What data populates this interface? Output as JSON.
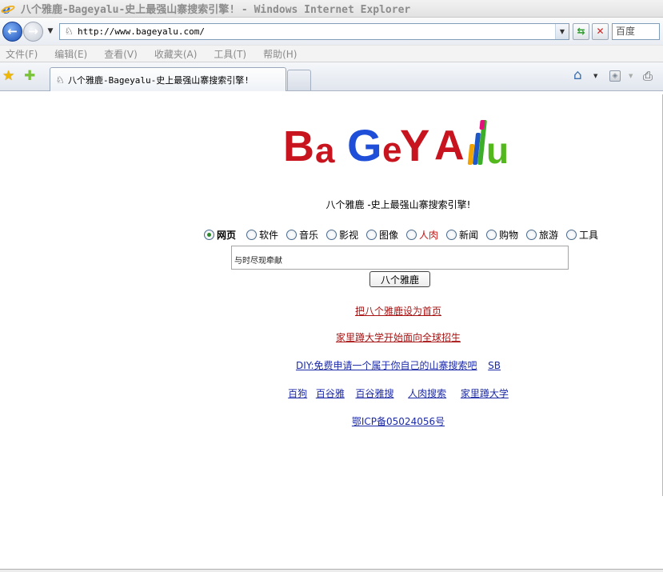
{
  "window": {
    "title": "八个雅鹿-Bageyalu-史上最强山寨搜索引擎! - Windows Internet Explorer"
  },
  "address_bar": {
    "url": "http://www.bageyalu.com/",
    "search_placeholder": "百度"
  },
  "menu": {
    "items": [
      "文件(F)",
      "编辑(E)",
      "查看(V)",
      "收藏夹(A)",
      "工具(T)",
      "帮助(H)"
    ]
  },
  "tabs": [
    {
      "title": "八个雅鹿-Bageyalu-史上最强山寨搜索引擎!"
    }
  ],
  "logo": {
    "letters": [
      "B",
      "a",
      "G",
      "e",
      "Y",
      "A",
      "u"
    ]
  },
  "page": {
    "tagline": "八个雅鹿 -史上最强山寨搜索引擎!",
    "search_categories": [
      {
        "label": "网页",
        "selected": true,
        "color": "#000000"
      },
      {
        "label": "软件",
        "selected": false,
        "color": "#000000"
      },
      {
        "label": "音乐",
        "selected": false,
        "color": "#000000"
      },
      {
        "label": "影视",
        "selected": false,
        "color": "#000000"
      },
      {
        "label": "图像",
        "selected": false,
        "color": "#000000"
      },
      {
        "label": "人肉",
        "selected": false,
        "color": "#cc1111"
      },
      {
        "label": "新闻",
        "selected": false,
        "color": "#000000"
      },
      {
        "label": "购物",
        "selected": false,
        "color": "#000000"
      },
      {
        "label": "旅游",
        "selected": false,
        "color": "#000000"
      },
      {
        "label": "工具",
        "selected": false,
        "color": "#000000"
      }
    ],
    "search_value": "与时尽现牵献",
    "search_button": "八个雅鹿",
    "set_homepage_link": "把八个雅鹿设为首页",
    "university_link": "家里蹲大学开始面向全球招生",
    "diy_link": "DIY:免费申请一个属于你自己的山寨搜索吧",
    "sb_link": "SB",
    "bottom_links": [
      "百狗",
      "百谷雅",
      "百谷雅搜",
      "人肉搜索",
      "家里蹲大学"
    ],
    "icp": "鄂ICP备05024056号"
  },
  "colors": {
    "link_red": "#aa1414",
    "link_blue": "#1c2aa8",
    "logo_red": "#c8141e",
    "logo_blue": "#1f4ed8",
    "logo_green": "#52b81c"
  }
}
